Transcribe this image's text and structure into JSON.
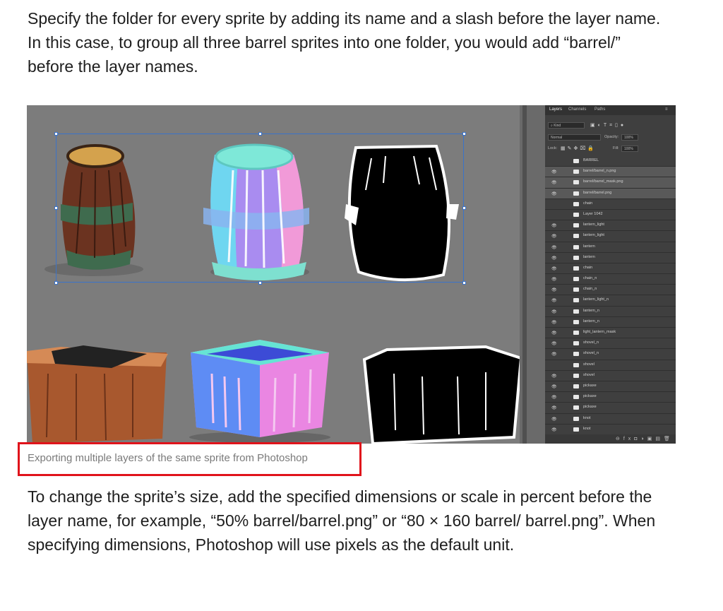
{
  "intro_text": "Specify the folder for every sprite by adding its name and a slash before the layer name. In this case, to group all three barrel sprites into one folder, you would add “barrel/” before the layer names.",
  "figure_caption": "Exporting multiple layers of the same sprite from Photoshop",
  "body_text": "To change the sprite’s size, add the specified dimensions or scale in percent before the layer name, for example, “50% barrel/barrel.png” or “80 × 160 barrel/ barrel.png”. When specifying dimensions, Photoshop will use pixels as the default unit.",
  "photoshop": {
    "tabs": [
      "Layers",
      "Channels",
      "Paths"
    ],
    "filter_label": "Kind",
    "blend_mode": "Normal",
    "opacity_label": "Opacity:",
    "opacity_value": "100%",
    "lock_label": "Lock:",
    "fill_label": "Fill:",
    "fill_value": "100%",
    "layers": [
      {
        "name": "BARREL",
        "visible": false,
        "selected": false
      },
      {
        "name": "barrel/barrel_n.png",
        "visible": true,
        "selected": true
      },
      {
        "name": "barrel/barrel_mask.png",
        "visible": true,
        "selected": true
      },
      {
        "name": "barrel/barrel.png",
        "visible": true,
        "selected": true
      },
      {
        "name": "chain",
        "visible": false,
        "selected": false
      },
      {
        "name": "Layer 1042",
        "visible": false,
        "selected": false
      },
      {
        "name": "lantern_light",
        "visible": true,
        "selected": false
      },
      {
        "name": "lantern_light",
        "visible": true,
        "selected": false
      },
      {
        "name": "lantern",
        "visible": true,
        "selected": false
      },
      {
        "name": "lantern",
        "visible": true,
        "selected": false
      },
      {
        "name": "chain",
        "visible": true,
        "selected": false
      },
      {
        "name": "chain_n",
        "visible": true,
        "selected": false
      },
      {
        "name": "chain_n",
        "visible": true,
        "selected": false
      },
      {
        "name": "lantern_light_n",
        "visible": true,
        "selected": false
      },
      {
        "name": "lantern_n",
        "visible": true,
        "selected": false
      },
      {
        "name": "lantern_n",
        "visible": true,
        "selected": false
      },
      {
        "name": "light_lantern_mask",
        "visible": true,
        "selected": false
      },
      {
        "name": "shovel_n",
        "visible": true,
        "selected": false
      },
      {
        "name": "shovel_n",
        "visible": true,
        "selected": false
      },
      {
        "name": "shovel",
        "visible": false,
        "selected": false
      },
      {
        "name": "shovel",
        "visible": true,
        "selected": false
      },
      {
        "name": "pickaxe",
        "visible": true,
        "selected": false
      },
      {
        "name": "pickaxe",
        "visible": true,
        "selected": false
      },
      {
        "name": "pickaxe",
        "visible": true,
        "selected": false
      },
      {
        "name": "knot",
        "visible": true,
        "selected": false
      },
      {
        "name": "knot",
        "visible": true,
        "selected": false
      }
    ]
  }
}
